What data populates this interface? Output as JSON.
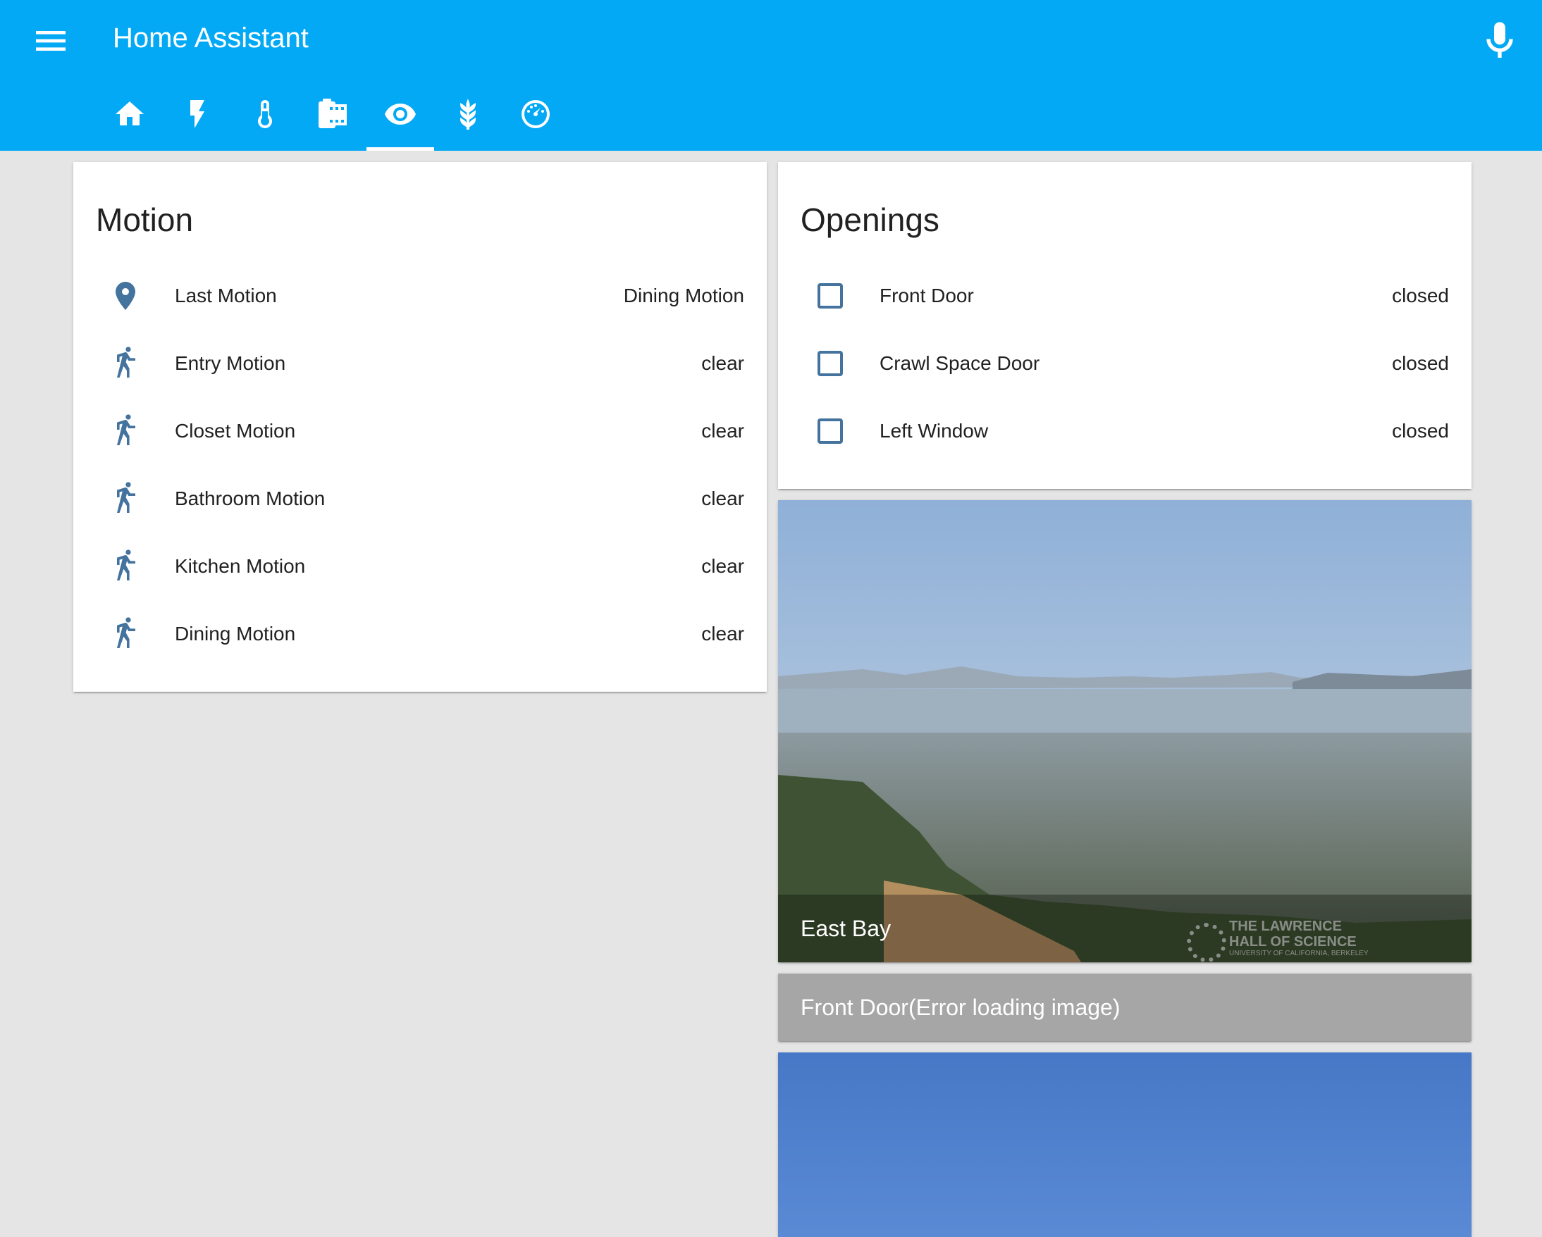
{
  "app": {
    "title": "Home Assistant",
    "menu_icon": "menu-icon",
    "mic_icon": "microphone-icon",
    "accent_color": "#03a9f4",
    "icon_color": "#44739e"
  },
  "tabs": [
    {
      "icon": "home-icon",
      "active": false
    },
    {
      "icon": "flash-icon",
      "active": false
    },
    {
      "icon": "thermometer-icon",
      "active": false
    },
    {
      "icon": "film-icon",
      "active": false
    },
    {
      "icon": "eye-icon",
      "active": true
    },
    {
      "icon": "barley-icon",
      "active": false
    },
    {
      "icon": "speedometer-icon",
      "active": false
    }
  ],
  "motion": {
    "title": "Motion",
    "rows": [
      {
        "icon": "map-marker-icon",
        "name": "Last Motion",
        "state": "Dining Motion"
      },
      {
        "icon": "walk-icon",
        "name": "Entry Motion",
        "state": "clear"
      },
      {
        "icon": "walk-icon",
        "name": "Closet Motion",
        "state": "clear"
      },
      {
        "icon": "walk-icon",
        "name": "Bathroom Motion",
        "state": "clear"
      },
      {
        "icon": "walk-icon",
        "name": "Kitchen Motion",
        "state": "clear"
      },
      {
        "icon": "walk-icon",
        "name": "Dining Motion",
        "state": "clear"
      }
    ]
  },
  "openings": {
    "title": "Openings",
    "rows": [
      {
        "icon": "checkbox-blank-outline-icon",
        "name": "Front Door",
        "state": "closed"
      },
      {
        "icon": "checkbox-blank-outline-icon",
        "name": "Crawl Space Door",
        "state": "closed"
      },
      {
        "icon": "checkbox-blank-outline-icon",
        "name": "Left Window",
        "state": "closed"
      }
    ]
  },
  "cameras": {
    "east_bay": {
      "caption": "East Bay",
      "watermark_line1": "THE LAWRENCE",
      "watermark_line2": "HALL OF SCIENCE",
      "watermark_line3": "UNIVERSITY OF CALIFORNIA, BERKELEY"
    },
    "front_door": {
      "caption": "Front Door(Error loading image)"
    }
  }
}
